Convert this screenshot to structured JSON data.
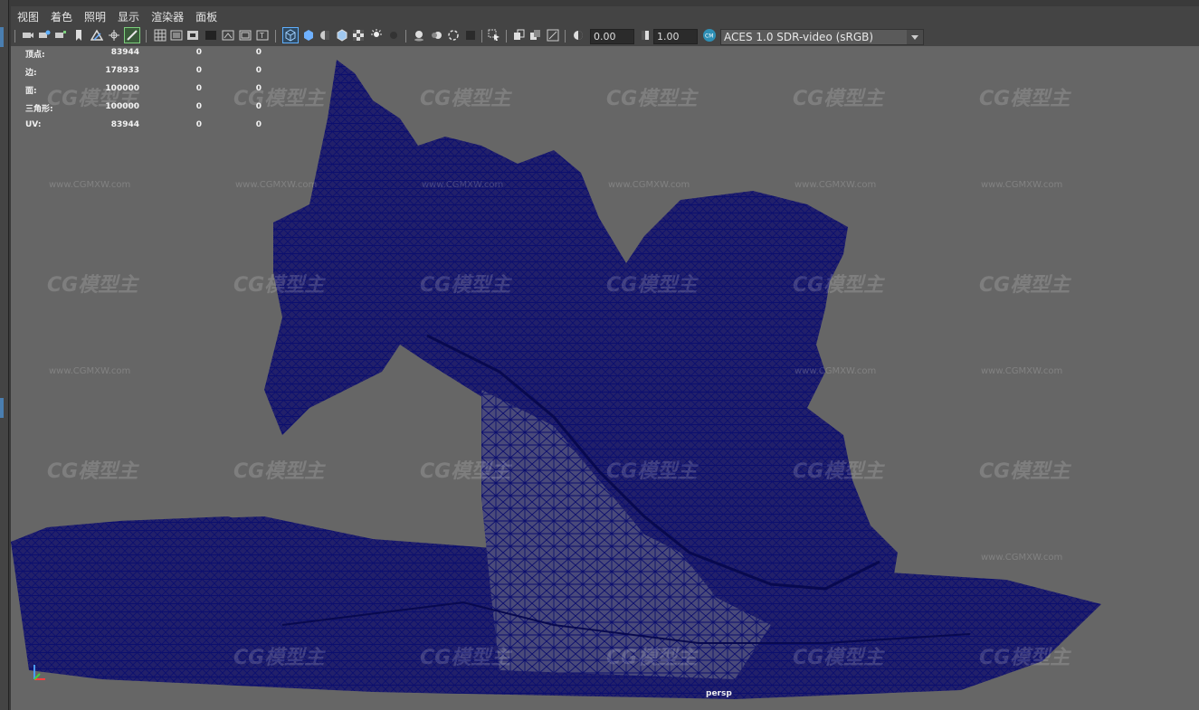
{
  "menu": [
    "视图",
    "着色",
    "照明",
    "显示",
    "渲染器",
    "面板"
  ],
  "toolbar": {
    "exposure_value": "0.00",
    "gamma_value": "1.00",
    "colorspace": "ACES 1.0 SDR-video (sRGB)"
  },
  "hud": {
    "rows": [
      {
        "label": "顶点:",
        "v1": "83944",
        "v2": "0",
        "v3": "0"
      },
      {
        "label": "边:",
        "v1": "178933",
        "v2": "0",
        "v3": "0"
      },
      {
        "label": "面:",
        "v1": "100000",
        "v2": "0",
        "v3": "0"
      },
      {
        "label": "三角形:",
        "v1": "100000",
        "v2": "0",
        "v3": "0"
      },
      {
        "label": "UV:",
        "v1": "83944",
        "v2": "0",
        "v3": "0"
      }
    ]
  },
  "camera_label": "persp",
  "watermark": {
    "logo": "CG模型主",
    "url": "www.CGMXW.com"
  },
  "colors": {
    "wireframe": "#0c0f6e",
    "viewport_bg": "#666666",
    "accent": "#4a7eb0"
  }
}
